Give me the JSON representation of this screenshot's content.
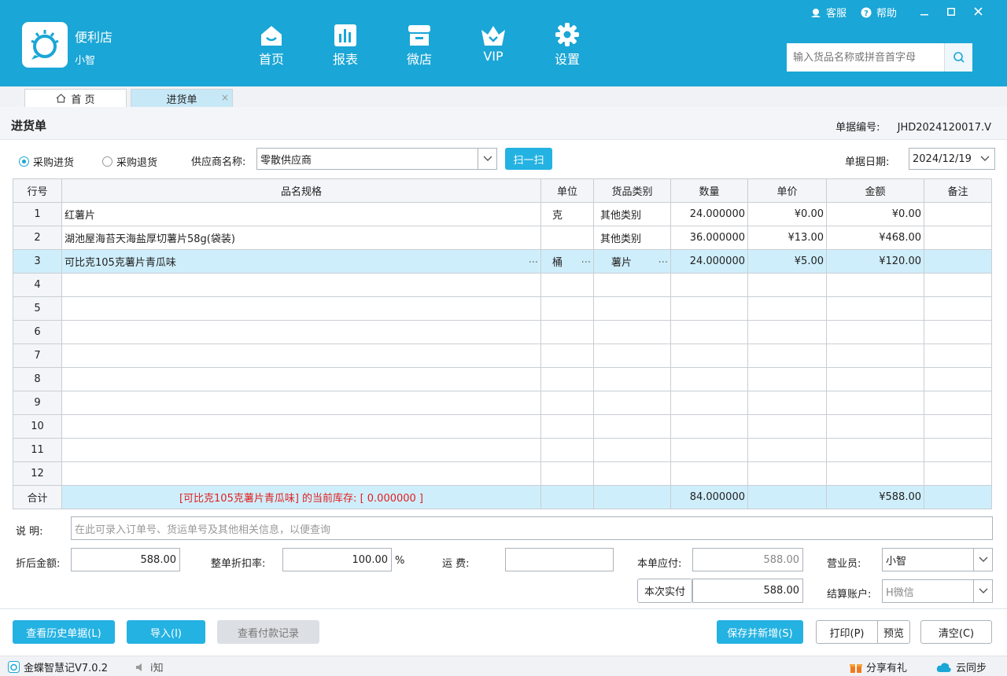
{
  "header": {
    "store_name": "便利店",
    "user_name": "小智",
    "nav": [
      {
        "label": "首页",
        "icon": "home-icon"
      },
      {
        "label": "报表",
        "icon": "report-icon"
      },
      {
        "label": "微店",
        "icon": "shop-icon"
      },
      {
        "label": "VIP",
        "icon": "vip-crown-icon"
      },
      {
        "label": "设置",
        "icon": "gear-icon"
      }
    ],
    "service": "客服",
    "help": "帮助",
    "search_placeholder": "输入货品名称或拼音首字母"
  },
  "tabs": {
    "home": "首 页",
    "active": "进货单",
    "close": "×"
  },
  "page": {
    "title": "进货单",
    "doc_no_label": "单据编号:",
    "doc_no": "JHD2024120017.V"
  },
  "form": {
    "radio_purchase": "采购进货",
    "radio_return": "采购退货",
    "supplier_label": "供应商名称:",
    "supplier": "零散供应商",
    "scan": "扫一扫",
    "date_label": "单据日期:",
    "date": "2024/12/19"
  },
  "table": {
    "headers": [
      "行号",
      "品名规格",
      "单位",
      "货品类别",
      "数量",
      "单价",
      "金额",
      "备注"
    ],
    "rows": [
      {
        "no": "1",
        "name": "红薯片",
        "unit": "克",
        "category": "其他类别",
        "qty": "24.000000",
        "price": "¥0.00",
        "amount": "¥0.00",
        "note": ""
      },
      {
        "no": "2",
        "name": "湖池屋海苔天海盐厚切薯片58g(袋装)",
        "unit": "",
        "category": "其他类别",
        "qty": "36.000000",
        "price": "¥13.00",
        "amount": "¥468.00",
        "note": ""
      },
      {
        "no": "3",
        "name": "可比克105克薯片青瓜味",
        "unit": "桶",
        "category": "薯片",
        "qty": "24.000000",
        "price": "¥5.00",
        "amount": "¥120.00",
        "note": ""
      },
      {
        "no": "4"
      },
      {
        "no": "5"
      },
      {
        "no": "6"
      },
      {
        "no": "7"
      },
      {
        "no": "8"
      },
      {
        "no": "9"
      },
      {
        "no": "10"
      },
      {
        "no": "11"
      },
      {
        "no": "12"
      }
    ],
    "dots": "...",
    "total_label": "合计",
    "stock_message": "[可比克105克薯片青瓜味] 的当前库存: [ 0.000000 ]",
    "total_qty": "84.000000",
    "total_amount": "¥588.00"
  },
  "bottom": {
    "note_label": "说  明:",
    "note_placeholder": "在此可录入订单号、货运单号及其他相关信息，以便查询",
    "discount_amount_label": "折后金额:",
    "discount_amount": "588.00",
    "discount_rate_label": "整单折扣率:",
    "discount_rate": "100.00",
    "percent": "%",
    "freight_label": "运    费:",
    "freight": "",
    "payable_label": "本单应付:",
    "payable": "588.00",
    "paid_button": "本次实付",
    "paid": "588.00",
    "salesman_label": "营业员:",
    "salesman": "小智",
    "account_label": "结算账户:",
    "account": "H微信"
  },
  "actions": {
    "history": "查看历史单据(L)",
    "import": "导入(I)",
    "payment_records": "查看付款记录",
    "save_new": "保存并新增(S)",
    "print": "打印(P)",
    "preview": "预览",
    "clear": "清空(C)"
  },
  "status": {
    "version": "金蝶智慧记V7.0.2",
    "notice": "i知",
    "share": "分享有礼",
    "sync": "云同步"
  },
  "colors": {
    "header_bg": "#1aa6d6",
    "primary_button": "#24b2e2",
    "selected_row": "#cfeefb",
    "stock_text": "#e02020"
  }
}
